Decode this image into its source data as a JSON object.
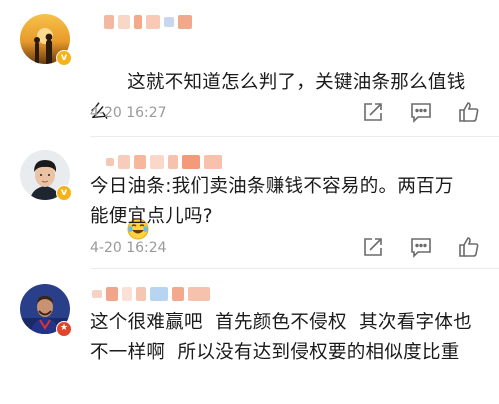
{
  "comments": [
    {
      "text": "这就不知道怎么判了，关键油条那么值钱么",
      "time": "4-20 16:27",
      "emoji": "laugh-cry-emoji",
      "badge": "v"
    },
    {
      "text": "今日油条:我们卖油条赚钱不容易的。两百万能便宜点儿吗?",
      "time": "4-20 16:24",
      "badge": "v"
    },
    {
      "text": "这个很难赢吧  首先颜色不侵权  其次看字体也不一样啊  所以没有达到侵权要的相似度比重",
      "badge": "★"
    }
  ],
  "colors": {
    "badge": "#f6b21a",
    "time": "#9a9a9a",
    "text": "#1a1a1a",
    "icon": "#6b6b6b"
  }
}
